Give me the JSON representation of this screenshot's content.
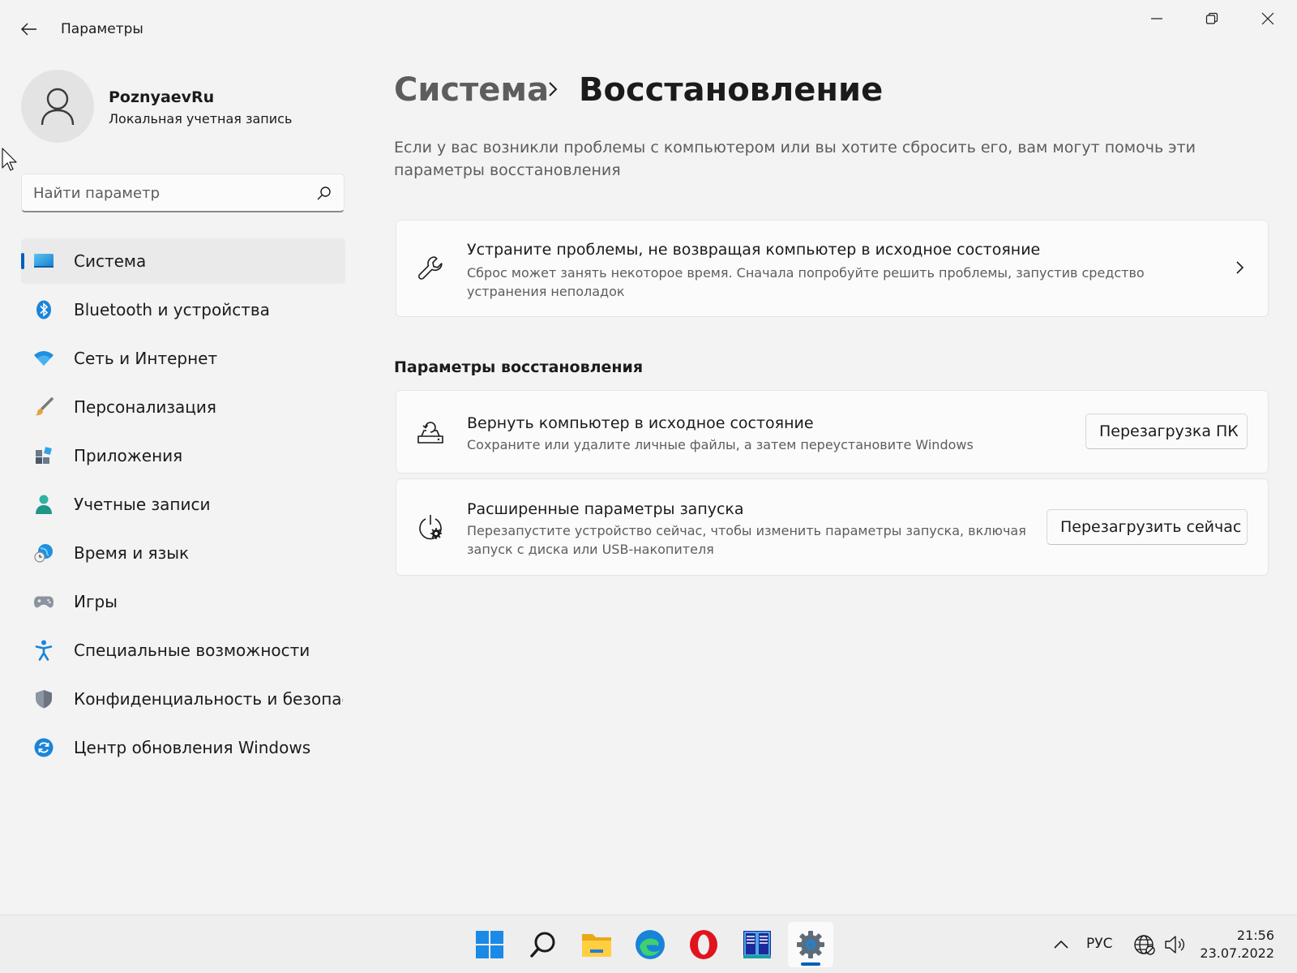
{
  "window": {
    "title": "Параметры",
    "controls": {
      "minimize_icon": "minimize-icon",
      "maximize_icon": "restore-icon",
      "close_icon": "close-icon"
    }
  },
  "user": {
    "name": "PoznyaevRu",
    "account_type": "Локальная учетная запись"
  },
  "search": {
    "placeholder": "Найти параметр",
    "value": ""
  },
  "sidebar": {
    "items": [
      {
        "label": "Система",
        "icon": "system-icon",
        "active": true
      },
      {
        "label": "Bluetooth и устройства",
        "icon": "bluetooth-icon"
      },
      {
        "label": "Сеть и Интернет",
        "icon": "wifi-icon"
      },
      {
        "label": "Персонализация",
        "icon": "brush-icon"
      },
      {
        "label": "Приложения",
        "icon": "apps-icon"
      },
      {
        "label": "Учетные записи",
        "icon": "person-icon"
      },
      {
        "label": "Время и язык",
        "icon": "globe-clock-icon"
      },
      {
        "label": "Игры",
        "icon": "gamepad-icon"
      },
      {
        "label": "Специальные возможности",
        "icon": "accessibility-icon"
      },
      {
        "label": "Конфиденциальность и безопас",
        "icon": "shield-icon"
      },
      {
        "label": "Центр обновления Windows",
        "icon": "update-icon"
      }
    ]
  },
  "breadcrumb": {
    "parent": "Система",
    "current": "Восстановление"
  },
  "intro": "Если у вас возникли проблемы с компьютером или вы хотите сбросить его, вам могут помочь эти параметры восстановления",
  "troubleshoot_card": {
    "title": "Устраните проблемы, не возвращая компьютер в исходное состояние",
    "description": "Сброс может занять некоторое время. Сначала попробуйте решить проблемы, запустив средство устранения неполадок"
  },
  "recovery_section": {
    "title": "Параметры восстановления",
    "reset": {
      "title": "Вернуть компьютер в исходное состояние",
      "description": "Сохраните или удалите личные файлы, а затем переустановите Windows",
      "button": "Перезагрузка ПК"
    },
    "advanced": {
      "title": "Расширенные параметры запуска",
      "description": "Перезапустите устройство сейчас, чтобы изменить параметры запуска, включая запуск с диска или USB-накопителя",
      "button": "Перезагрузить сейчас"
    }
  },
  "taskbar": {
    "apps": [
      "start-icon",
      "search-icon",
      "file-explorer-icon",
      "edge-icon",
      "opera-icon",
      "far-manager-icon",
      "settings-icon"
    ],
    "active_app": "settings-icon",
    "language": "РУС",
    "time": "21:56",
    "date": "23.07.2022"
  },
  "colors": {
    "accent": "#005fb8",
    "background": "#f3f3f3",
    "card": "#fbfbfb"
  }
}
